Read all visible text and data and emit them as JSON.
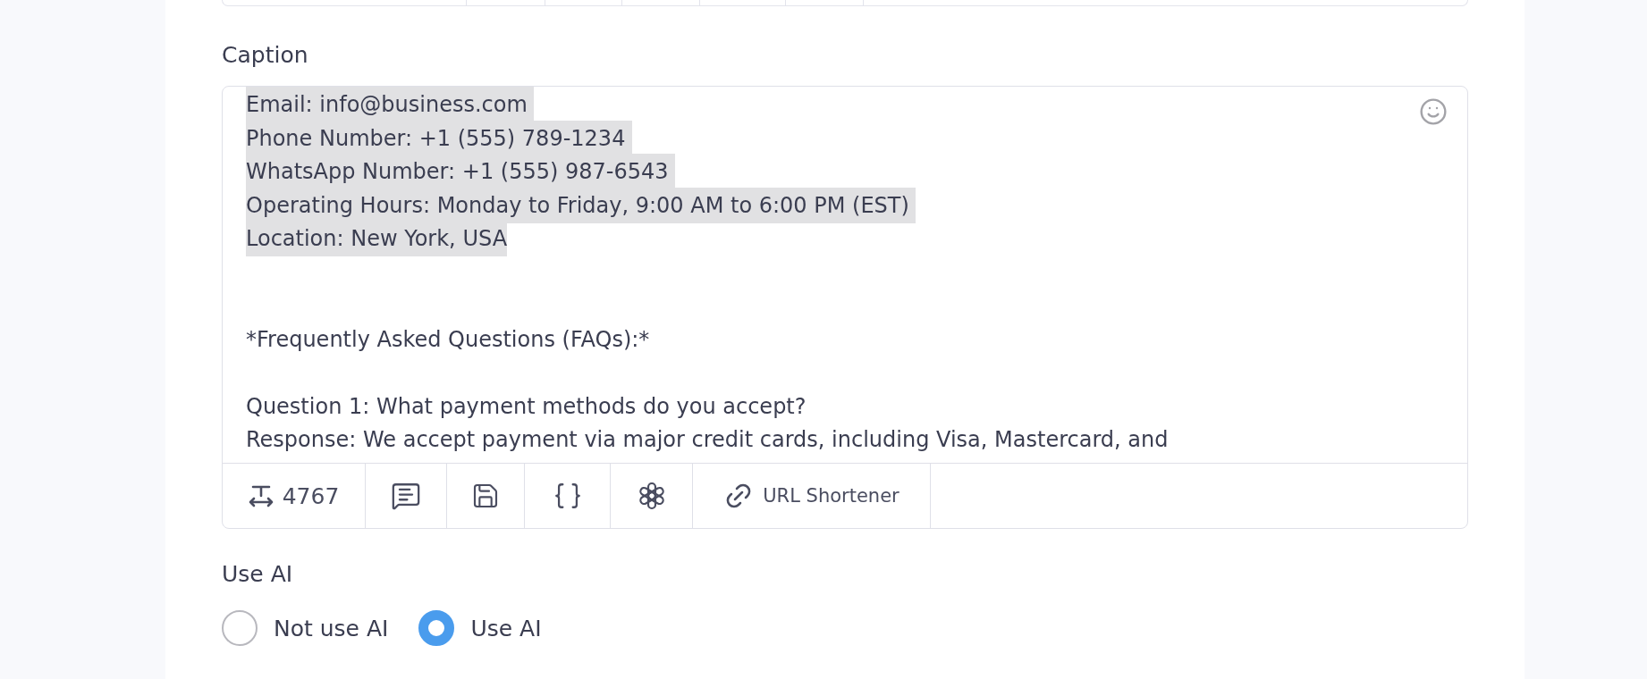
{
  "caption": {
    "label": "Caption",
    "lines": [
      {
        "kind": "text",
        "text": "Email: info@business.com ",
        "selected": true
      },
      {
        "kind": "text",
        "text": "Phone Number: +1 (555) 789-1234 ",
        "selected": true
      },
      {
        "kind": "text",
        "text": "WhatsApp Number: +1 (555) 987-6543 ",
        "selected": true
      },
      {
        "kind": "text",
        "text": "Operating Hours: Monday to Friday, 9:00 AM to 6:00 PM (EST) ",
        "selected": true
      },
      {
        "kind": "text",
        "text": "Location: New York, USA",
        "selected": true
      },
      {
        "kind": "blank"
      },
      {
        "kind": "blank"
      },
      {
        "kind": "text",
        "text": "*Frequently Asked Questions (FAQs):*",
        "selected": false
      },
      {
        "kind": "blank"
      },
      {
        "kind": "text",
        "text": "Question 1: What payment methods do you accept?",
        "selected": false
      },
      {
        "kind": "text",
        "text": "Response: We accept payment via major credit cards, including Visa, Mastercard, and",
        "selected": false
      }
    ],
    "toolbar": [
      {
        "kind": "count",
        "text": "4767"
      },
      {
        "kind": "comment"
      },
      {
        "kind": "save"
      },
      {
        "kind": "braces"
      },
      {
        "kind": "ai"
      },
      {
        "kind": "link",
        "text": "URL Shortener"
      }
    ]
  },
  "use_ai": {
    "label": "Use AI",
    "options": [
      {
        "label": "Not use AI",
        "selected": false
      },
      {
        "label": "Use AI",
        "selected": true
      }
    ]
  }
}
